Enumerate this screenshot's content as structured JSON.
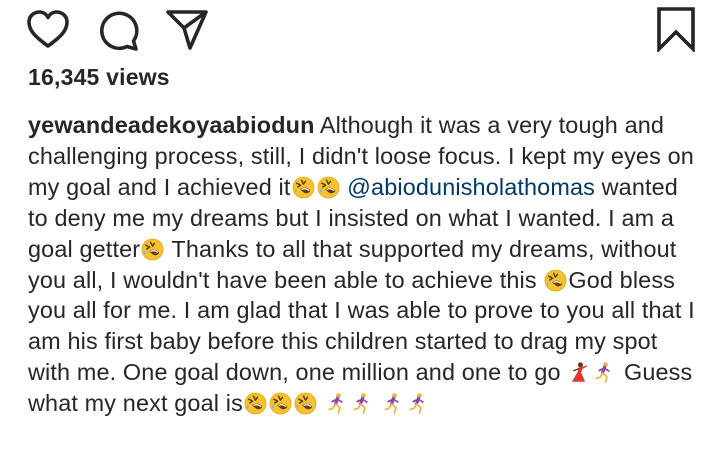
{
  "actions": {
    "like_icon": "heart-icon",
    "comment_icon": "comment-icon",
    "share_icon": "paper-plane-icon",
    "save_icon": "bookmark-icon"
  },
  "post": {
    "views": "16,345 views",
    "username": "yewandeadekoyaabiodun",
    "caption_part1": "Although it was a very tough and challenging process, still, I didn't loose focus. I kept my eyes on my goal and I achieved it",
    "mention": "@abiodunisholathomas",
    "caption_part2": "wanted to deny me my dreams but I insisted on what I wanted. I am a goal getter",
    "caption_part3": "Thanks to all that supported my dreams, without you all, I wouldn't have been able to achieve this",
    "caption_part4": "God bless you all for me. I am glad that I was able to prove to you all that I am his first baby before this children started to drag my spot with me. One goal down, one million and one to go",
    "caption_part5": "Guess what my next goal is",
    "emojis": [
      "rolling-on-floor-laughing",
      "dancer",
      "woman-running"
    ]
  },
  "colors": {
    "text": "#262626",
    "mention": "#00376b",
    "background": "#ffffff"
  }
}
